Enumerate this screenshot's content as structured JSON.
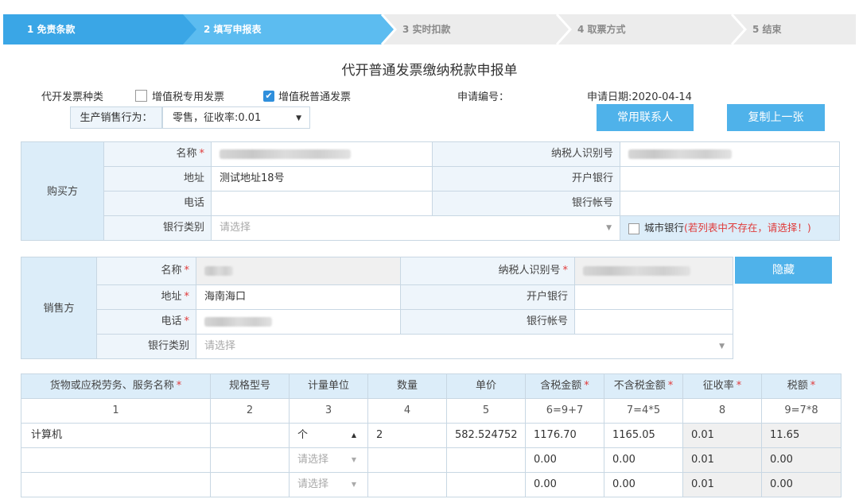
{
  "steps": [
    {
      "label": "1  免责条款",
      "state": "active"
    },
    {
      "label": "2  填写申报表",
      "state": "current"
    },
    {
      "label": "3  实时扣款",
      "state": "pending"
    },
    {
      "label": "4  取票方式",
      "state": "pending"
    },
    {
      "label": "5  结束",
      "state": "pending"
    }
  ],
  "form": {
    "title": "代开普通发票缴纳税款申报单",
    "invoice_type_label": "代开发票种类",
    "invoice_type_options": [
      {
        "label": "增值税专用发票",
        "checked": false
      },
      {
        "label": "增值税普通发票",
        "checked": true
      }
    ],
    "apply_no_label": "申请编号：",
    "apply_date": "申请日期:2020-04-14",
    "sales_behavior_label": "生产销售行为：",
    "sales_behavior_value": "零售，征收率:0.01",
    "contacts_button": "常用联系人",
    "copy_button": "复制上一张"
  },
  "buyer": {
    "section": "购买方",
    "name_label": "名称",
    "tax_id_label": "纳税人识别号",
    "address_label": "地址",
    "address_value": "测试地址18号",
    "bank_label": "开户银行",
    "phone_label": "电话",
    "account_label": "银行帐号",
    "bank_type_label": "银行类别",
    "bank_type_placeholder": "请选择",
    "city_bank_label": "城市银行",
    "city_bank_note": "(若列表中不存在，请选择！)",
    "required_mark": "*"
  },
  "seller": {
    "section": "销售方",
    "name_label": "名称",
    "tax_id_label": "纳税人识别号",
    "hide_button": "隐藏",
    "address_label": "地址",
    "address_value": "海南海口",
    "bank_label": "开户银行",
    "phone_label": "电话",
    "account_label": "银行帐号",
    "bank_type_label": "银行类别",
    "bank_type_placeholder": "请选择",
    "required_mark": "*"
  },
  "goods": {
    "headers": [
      "货物或应税劳务、服务名称",
      "规格型号",
      "计量单位",
      "数量",
      "单价",
      "含税金额",
      "不含税金额",
      "征收率",
      "税额"
    ],
    "required": [
      true,
      false,
      false,
      false,
      false,
      true,
      true,
      true,
      true
    ],
    "formula_row": [
      "1",
      "2",
      "3",
      "4",
      "5",
      "6=9+7",
      "7=4*5",
      "8",
      "9=7*8"
    ],
    "unit_placeholder": "请选择",
    "rows": [
      {
        "name": "计算机",
        "spec": "",
        "unit": "个",
        "qty": "2",
        "price": "582.524752",
        "incl": "1176.70",
        "excl": "1165.05",
        "rate": "0.01",
        "tax": "11.65"
      },
      {
        "name": "",
        "spec": "",
        "unit": "",
        "qty": "",
        "price": "",
        "incl": "0.00",
        "excl": "0.00",
        "rate": "0.01",
        "tax": "0.00"
      },
      {
        "name": "",
        "spec": "",
        "unit": "",
        "qty": "",
        "price": "",
        "incl": "0.00",
        "excl": "0.00",
        "rate": "0.01",
        "tax": "0.00"
      }
    ]
  },
  "colors": {
    "accent": "#4fb2ea",
    "step_active": "#3aa6e6",
    "step_inactive": "#ececec",
    "required": "#e03a3a",
    "label_bg": "#eef5fb",
    "section_bg": "#dcedf9"
  }
}
